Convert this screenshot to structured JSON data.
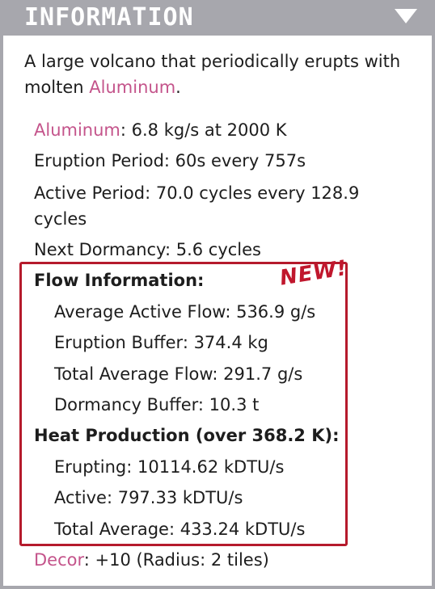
{
  "header": {
    "title": "INFORMATION"
  },
  "description": {
    "text": "A large volcano that periodically erupts with molten ",
    "element": "Aluminum",
    "end": "."
  },
  "stats": {
    "element_link": "Aluminum",
    "element_rate": ": 6.8 kg/s at 2000 K",
    "eruption_period": "Eruption Period: 60s every 757s",
    "active_period": "Active Period: 70.0 cycles every 128.9 cycles",
    "next_dormancy": "Next Dormancy: 5.6 cycles"
  },
  "flow": {
    "heading": "Flow Information:",
    "badge": "NEW!",
    "items": [
      "Average Active Flow: 536.9 g/s",
      "Eruption Buffer: 374.4 kg",
      "Total Average Flow: 291.7 g/s",
      "Dormancy Buffer: 10.3 t"
    ]
  },
  "heat": {
    "heading": "Heat Production (over 368.2 K):",
    "items": [
      "Erupting: 10114.62 kDTU/s",
      "Active: 797.33 kDTU/s",
      "Total Average: 433.24 kDTU/s"
    ]
  },
  "decor": {
    "label": "Decor",
    "value": ": +10 (Radius: 2 tiles)"
  },
  "colors": {
    "accent": "#c4548b",
    "highlight_border": "#b51a2c",
    "header_bg": "#a7a7ad"
  }
}
